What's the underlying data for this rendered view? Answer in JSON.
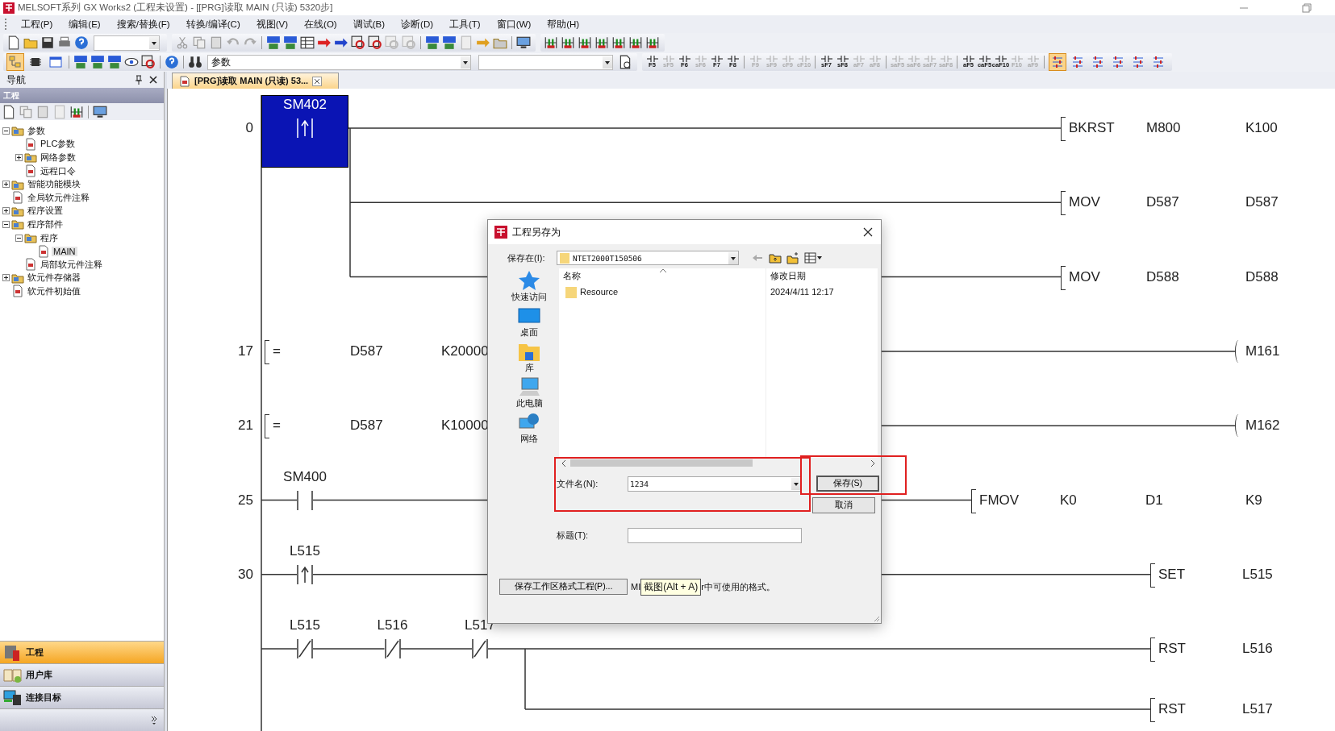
{
  "window": {
    "title": "MELSOFT系列 GX Works2 (工程未设置) - [[PRG]读取 MAIN (只读) 5320步]"
  },
  "menu": [
    "工程(P)",
    "编辑(E)",
    "搜索/替换(F)",
    "转换/编译(C)",
    "视图(V)",
    "在线(O)",
    "调试(B)",
    "诊断(D)",
    "工具(T)",
    "窗口(W)",
    "帮助(H)"
  ],
  "toolbar": {
    "mode_buttons": [
      {
        "selected": true
      },
      {
        "selected": false
      },
      {
        "selected": false
      }
    ],
    "search_combo": {
      "value": "参数"
    },
    "key_buttons": [
      {
        "label": "F5",
        "disabled": false
      },
      {
        "label": "sF5",
        "disabled": true
      },
      {
        "label": "F6",
        "disabled": false
      },
      {
        "label": "sF6",
        "disabled": true
      },
      {
        "label": "F7",
        "disabled": false
      },
      {
        "label": "F8",
        "disabled": false
      },
      {
        "label": "F9",
        "disabled": true
      },
      {
        "label": "sF9",
        "disabled": true
      },
      {
        "label": "cF9",
        "disabled": true
      },
      {
        "label": "cF10",
        "disabled": true
      },
      {
        "label": "sF7",
        "disabled": false
      },
      {
        "label": "sF8",
        "disabled": false
      },
      {
        "label": "aF7",
        "disabled": true
      },
      {
        "label": "aF8",
        "disabled": true
      },
      {
        "label": "saF5",
        "disabled": true
      },
      {
        "label": "saF6",
        "disabled": true
      },
      {
        "label": "saF7",
        "disabled": true
      },
      {
        "label": "saF8",
        "disabled": true
      },
      {
        "label": "aF5",
        "disabled": false
      },
      {
        "label": "caF5",
        "disabled": false
      },
      {
        "label": "caF10",
        "disabled": false
      },
      {
        "label": "F10",
        "disabled": true
      },
      {
        "label": "aF9",
        "disabled": true
      }
    ],
    "display_buttons": [
      {
        "selected": true
      },
      {
        "selected": false
      },
      {
        "selected": false
      },
      {
        "selected": false
      },
      {
        "selected": false
      },
      {
        "selected": false
      }
    ]
  },
  "nav": {
    "title": "导航",
    "section": "工程",
    "tree": [
      {
        "label": "参数",
        "expanded": true,
        "selected": false,
        "children": [
          {
            "label": "PLC参数",
            "selected": false
          },
          {
            "label": "网络参数",
            "expanded": false,
            "selected": false
          },
          {
            "label": "远程口令",
            "selected": false
          }
        ]
      },
      {
        "label": "智能功能模块",
        "expanded": false,
        "selected": false
      },
      {
        "label": "全局软元件注释",
        "selected": false
      },
      {
        "label": "程序设置",
        "expanded": false,
        "selected": false
      },
      {
        "label": "程序部件",
        "expanded": true,
        "selected": false,
        "children": [
          {
            "label": "程序",
            "expanded": true,
            "selected": false,
            "children": [
              {
                "label": "MAIN",
                "selected": true
              }
            ]
          },
          {
            "label": "局部软元件注释",
            "selected": false
          }
        ]
      },
      {
        "label": "软元件存储器",
        "expanded": false,
        "selected": false
      },
      {
        "label": "软元件初始值",
        "selected": false
      }
    ],
    "categories": [
      {
        "label": "工程",
        "selected": true
      },
      {
        "label": "用户库",
        "selected": false
      },
      {
        "label": "连接目标",
        "selected": false
      }
    ]
  },
  "tabs": [
    {
      "label": "[PRG]读取 MAIN (只读) 53...",
      "selected": true
    }
  ],
  "ladder": {
    "rungs": [
      {
        "step": "0",
        "contacts": [
          {
            "label": "SM402",
            "kind": "rising",
            "selected": true
          }
        ],
        "outputs": [
          {
            "kind": "instruction",
            "parts": [
              "BKRST",
              "M800",
              "K100"
            ]
          },
          {
            "kind": "instruction",
            "parts": [
              "MOV",
              "D587",
              "D587"
            ]
          },
          {
            "kind": "instruction",
            "parts": [
              "MOV",
              "D588",
              "D588"
            ]
          }
        ]
      },
      {
        "step": "17",
        "compare": {
          "op": "=",
          "operands": [
            "D587",
            "K20000"
          ]
        },
        "outputs": [
          {
            "kind": "coil",
            "parts": [
              "M161"
            ]
          }
        ]
      },
      {
        "step": "21",
        "compare": {
          "op": "=",
          "operands": [
            "D587",
            "K10000"
          ]
        },
        "outputs": [
          {
            "kind": "coil",
            "parts": [
              "M162"
            ]
          }
        ]
      },
      {
        "step": "25",
        "contacts": [
          {
            "label": "SM400",
            "kind": "open",
            "selected": false
          }
        ],
        "outputs": [
          {
            "kind": "instruction",
            "parts": [
              "FMOV",
              "K0",
              "D1",
              "K9"
            ]
          }
        ]
      },
      {
        "step": "30",
        "contacts": [
          {
            "label": "L515",
            "kind": "rising",
            "selected": false
          }
        ],
        "outputs": [
          {
            "kind": "instruction",
            "parts": [
              "SET",
              "L515"
            ]
          }
        ]
      },
      {
        "contacts": [
          {
            "label": "L515",
            "kind": "closed",
            "selected": false
          },
          {
            "label": "L516",
            "kind": "closed",
            "selected": false
          },
          {
            "label": "L517",
            "kind": "closed",
            "selected": false
          }
        ],
        "outputs": [
          {
            "kind": "instruction",
            "parts": [
              "RST",
              "L516"
            ]
          },
          {
            "kind": "instruction",
            "parts": [
              "RST",
              "L517"
            ]
          }
        ]
      }
    ]
  },
  "dialog": {
    "title": "工程另存为",
    "save_in_label": "保存在(I):",
    "save_in_value": "NTET2000T150506",
    "places": [
      {
        "label": "快速访问",
        "kind": "star"
      },
      {
        "label": "桌面",
        "kind": "desktop"
      },
      {
        "label": "库",
        "kind": "library"
      },
      {
        "label": "此电脑",
        "kind": "computer"
      },
      {
        "label": "网络",
        "kind": "network"
      }
    ],
    "columns": [
      "名称",
      "修改日期"
    ],
    "files": [
      {
        "name": "Resource",
        "modified": "2024/4/11 12:17"
      }
    ],
    "filename_label": "文件名(N):",
    "filename": "1234",
    "title_label": "标题(T):",
    "save_button": "保存(S)",
    "cancel_button": "取消",
    "workspace_button": "保存工作区格式工程(P)...",
    "note_start": "MI",
    "note_end": "r中可使用的格式。"
  },
  "tooltip": {
    "text": "截图(Alt + A)"
  },
  "annotations": [
    {
      "kind": "highlight"
    },
    {
      "kind": "highlight"
    }
  ]
}
